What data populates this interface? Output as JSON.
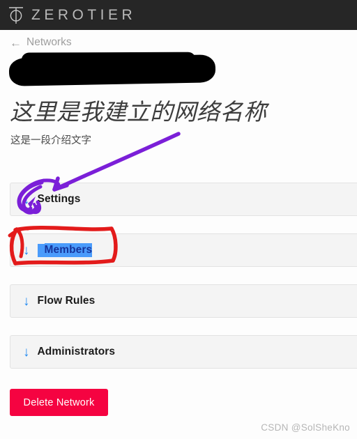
{
  "header": {
    "brand": "ZEROTIER",
    "logo_icon": "zerotier-logo-icon",
    "background_color": "#262626",
    "text_color": "#b9b9b9"
  },
  "breadcrumb": {
    "back_arrow_icon": "arrow-left-icon",
    "label": "Networks"
  },
  "network": {
    "id_redacted": true,
    "title": "这里是我建立的网络名称",
    "description": "这是一段介绍文字"
  },
  "accordion": {
    "arrow_icon": "arrow-down-icon",
    "arrow_color": "#1E88F0",
    "sections": [
      {
        "label": "Settings",
        "selected": false
      },
      {
        "label": "Members",
        "selected": true
      },
      {
        "label": "Flow Rules",
        "selected": false
      },
      {
        "label": "Administrators",
        "selected": false
      }
    ]
  },
  "actions": {
    "delete_label": "Delete Network",
    "delete_color": "#F50341"
  },
  "watermark": {
    "text": "CSDN @SolSheKno"
  },
  "annotations": {
    "purple_color": "#7B1FD8",
    "red_color": "#E31B1B",
    "purple_target": "Settings",
    "red_target": "Members"
  }
}
